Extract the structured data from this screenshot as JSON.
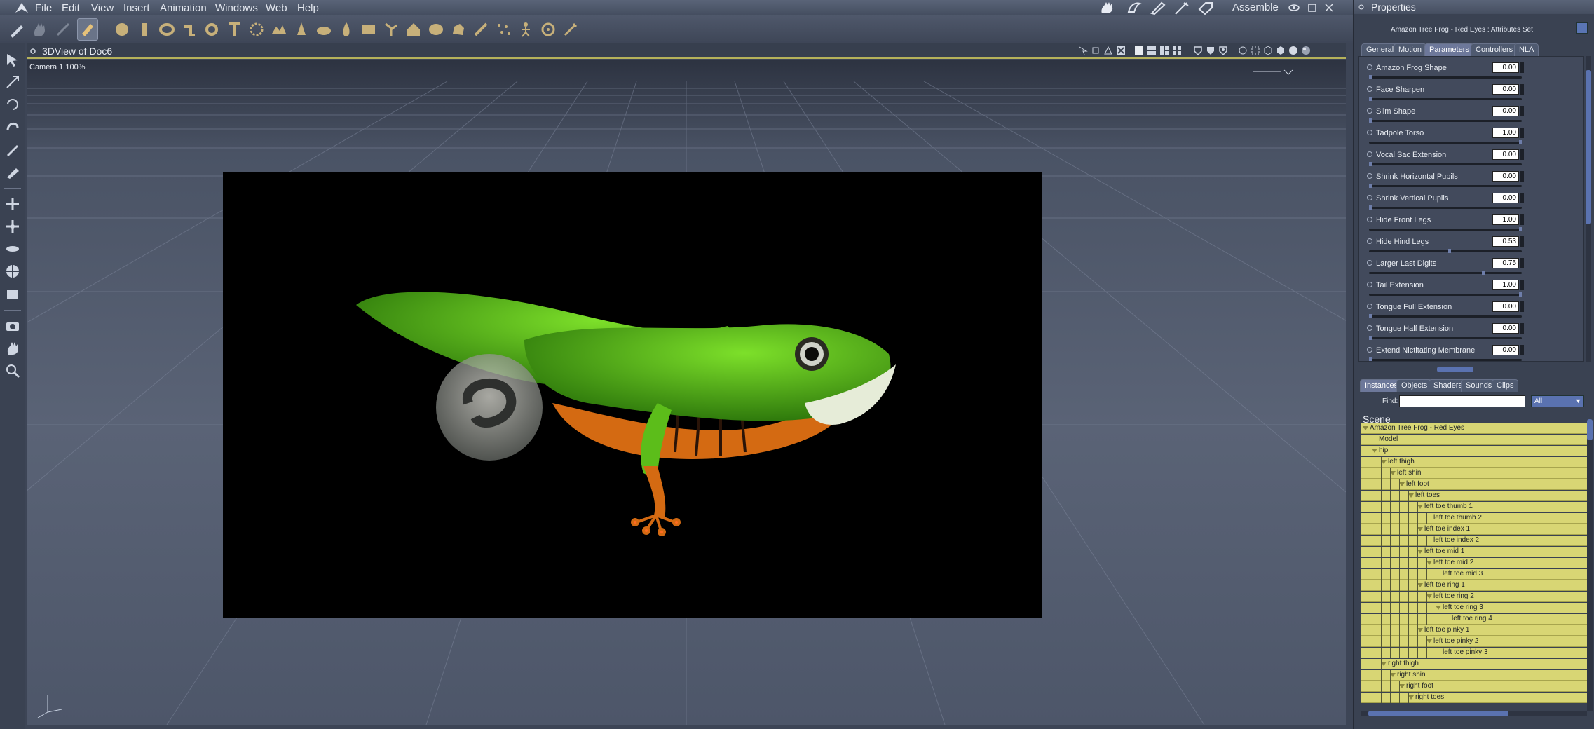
{
  "menubar": {
    "items": [
      "File",
      "Edit",
      "View",
      "Insert",
      "Animation",
      "Windows",
      "Web",
      "Help"
    ],
    "room": "Assemble"
  },
  "viewport": {
    "title": "3DView of Doc6",
    "camera_label": "Camera 1  100%"
  },
  "properties": {
    "panel_title": "Properties",
    "object_title": "Amazon Tree Frog - Red Eyes : Attributes Set",
    "tabs": [
      "General",
      "Motion",
      "Parameters",
      "Controllers",
      "NLA"
    ],
    "active_tab": "Parameters",
    "params": [
      {
        "label": "Amazon Frog Shape",
        "value": "0.00",
        "level": 0.0
      },
      {
        "label": "Face Sharpen",
        "value": "0.00",
        "level": 0.0
      },
      {
        "label": "Slim Shape",
        "value": "0.00",
        "level": 0.0
      },
      {
        "label": "Tadpole Torso",
        "value": "1.00",
        "level": 1.0
      },
      {
        "label": "Vocal Sac Extension",
        "value": "0.00",
        "level": 0.0
      },
      {
        "label": "Shrink Horizontal Pupils",
        "value": "0.00",
        "level": 0.0
      },
      {
        "label": "Shrink Vertical Pupils",
        "value": "0.00",
        "level": 0.0
      },
      {
        "label": "Hide Front Legs",
        "value": "1.00",
        "level": 1.0
      },
      {
        "label": "Hide Hind Legs",
        "value": "0.53",
        "level": 0.53
      },
      {
        "label": "Larger Last Digits",
        "value": "0.75",
        "level": 0.75
      },
      {
        "label": "Tail Extension",
        "value": "1.00",
        "level": 1.0
      },
      {
        "label": "Tongue Full Extension",
        "value": "0.00",
        "level": 0.0
      },
      {
        "label": "Tongue Half Extension",
        "value": "0.00",
        "level": 0.0
      },
      {
        "label": "Extend Nictitating Membrane",
        "value": "0.00",
        "level": 0.0
      }
    ]
  },
  "scene": {
    "tabs": [
      "Instances",
      "Objects",
      "Shaders",
      "Sounds",
      "Clips"
    ],
    "active_tab": "Instances",
    "find_label": "Find:",
    "find_value": "",
    "filter_value": "All",
    "heading": "Scene",
    "tree": [
      {
        "label": "Amazon Tree Frog - Red Eyes",
        "depth": 0,
        "arrow": true
      },
      {
        "label": "Model",
        "depth": 1,
        "arrow": false
      },
      {
        "label": "hip",
        "depth": 1,
        "arrow": true
      },
      {
        "label": "left thigh",
        "depth": 2,
        "arrow": true
      },
      {
        "label": "left shin",
        "depth": 3,
        "arrow": true
      },
      {
        "label": "left foot",
        "depth": 4,
        "arrow": true
      },
      {
        "label": "left toes",
        "depth": 5,
        "arrow": true
      },
      {
        "label": "left toe thumb 1",
        "depth": 6,
        "arrow": true
      },
      {
        "label": "left toe thumb 2",
        "depth": 7,
        "arrow": false
      },
      {
        "label": "left toe index 1",
        "depth": 6,
        "arrow": true
      },
      {
        "label": "left toe index 2",
        "depth": 7,
        "arrow": false
      },
      {
        "label": "left toe mid 1",
        "depth": 6,
        "arrow": true
      },
      {
        "label": "left toe mid 2",
        "depth": 7,
        "arrow": true
      },
      {
        "label": "left toe mid 3",
        "depth": 8,
        "arrow": false
      },
      {
        "label": "left toe ring 1",
        "depth": 6,
        "arrow": true
      },
      {
        "label": "left toe ring 2",
        "depth": 7,
        "arrow": true
      },
      {
        "label": "left toe ring 3",
        "depth": 8,
        "arrow": true
      },
      {
        "label": "left toe ring 4",
        "depth": 9,
        "arrow": false
      },
      {
        "label": "left toe pinky 1",
        "depth": 6,
        "arrow": true
      },
      {
        "label": "left toe pinky 2",
        "depth": 7,
        "arrow": true
      },
      {
        "label": "left toe pinky 3",
        "depth": 8,
        "arrow": false
      },
      {
        "label": "right thigh",
        "depth": 2,
        "arrow": true
      },
      {
        "label": "right shin",
        "depth": 3,
        "arrow": true
      },
      {
        "label": "right foot",
        "depth": 4,
        "arrow": true
      },
      {
        "label": "right toes",
        "depth": 5,
        "arrow": true
      }
    ]
  },
  "colors": {
    "accent_yellow": "#d8d674",
    "frog_green": "#5cbd1a",
    "frog_orange": "#d46a12"
  }
}
